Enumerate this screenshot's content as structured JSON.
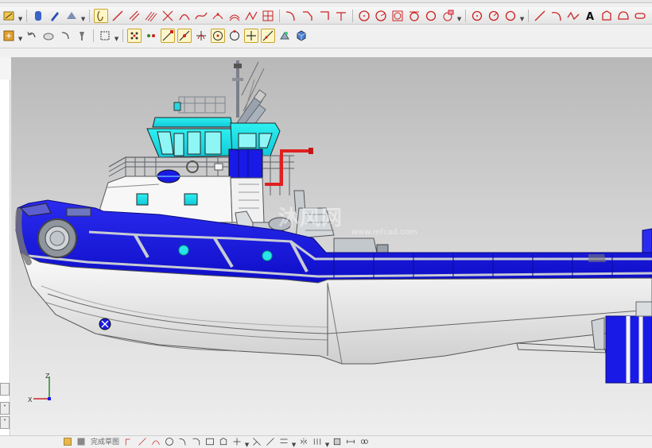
{
  "bottom_toolbar": {
    "finish_sketch_label": "完成草图"
  },
  "viewport": {
    "watermark": "沐风网",
    "watermark_sub": "www.mfcad.com",
    "triad": {
      "x": "X",
      "z": "Z"
    }
  },
  "colors": {
    "hull_blue": "#1a1ae6",
    "hull_white": "#f2f2f2",
    "wheelhouse_cyan": "#19e6e6",
    "exhaust_red": "#e02020",
    "viewport_top": "#b8b8b8",
    "viewport_bottom": "#eeeeee"
  },
  "icons": [
    "sketch-icon",
    "line-icon",
    "arc-icon",
    "circle-icon",
    "rectangle-icon",
    "spline-icon",
    "point-icon",
    "offset-icon",
    "trim-icon",
    "text-icon",
    "snap-icon"
  ]
}
